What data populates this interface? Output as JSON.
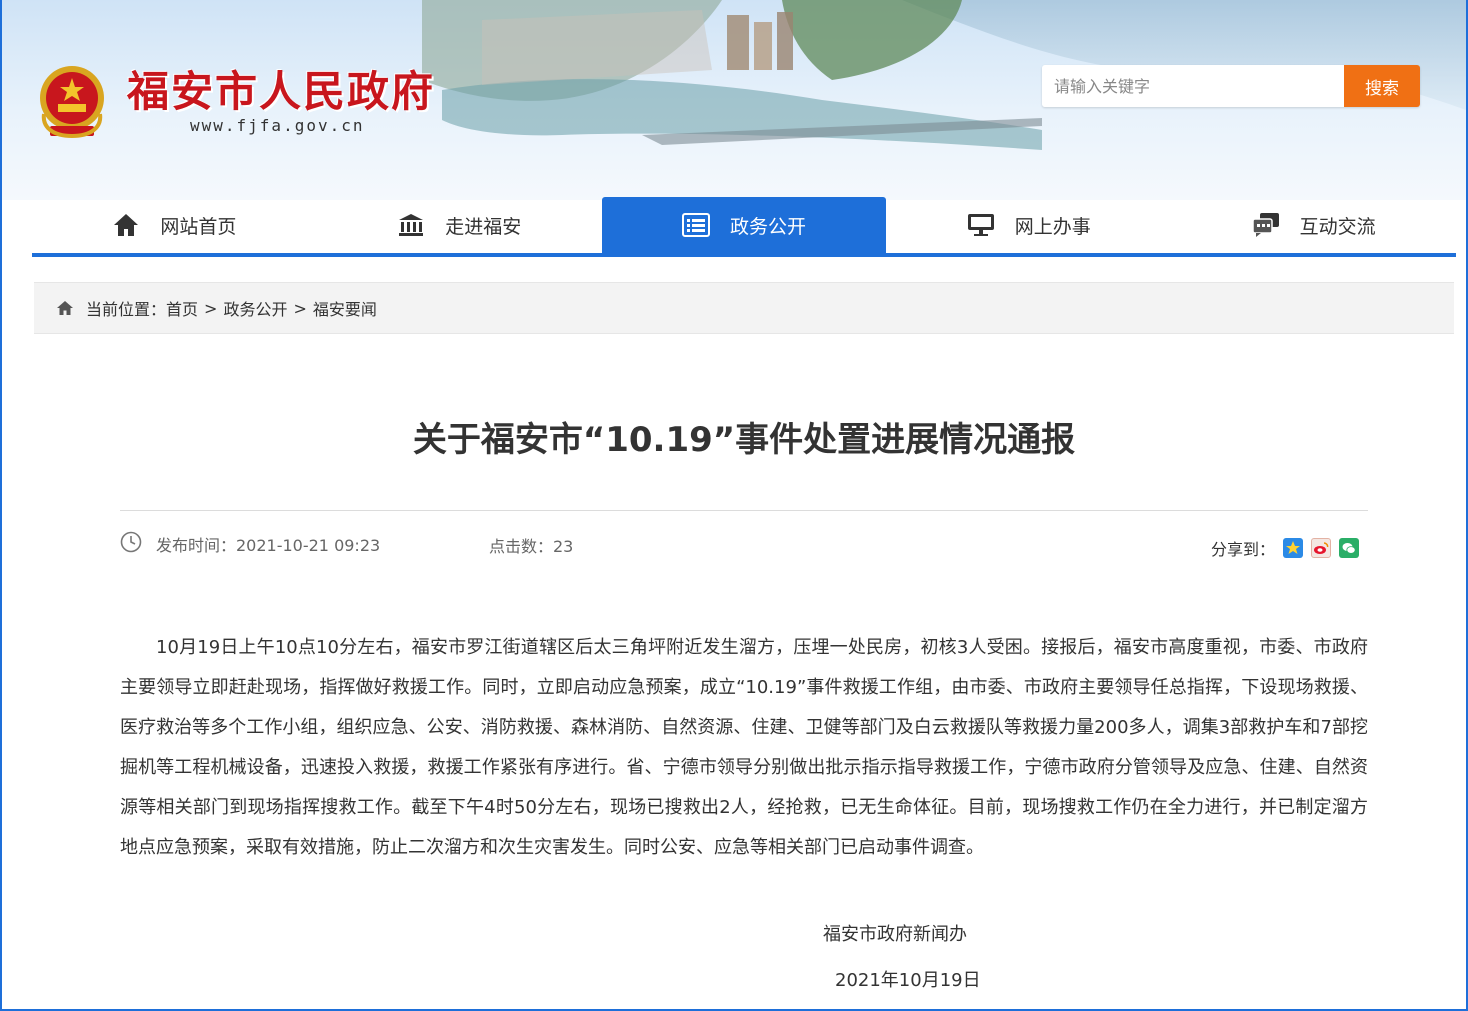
{
  "header": {
    "site_title": "福安市人民政府",
    "site_url": "www.fjfa.gov.cn",
    "search_placeholder": "请输入关键字",
    "search_button": "搜索"
  },
  "nav": {
    "items": [
      {
        "label": "网站首页",
        "icon": "home-icon"
      },
      {
        "label": "走进福安",
        "icon": "building-icon"
      },
      {
        "label": "政务公开",
        "icon": "list-icon",
        "active": true
      },
      {
        "label": "网上办事",
        "icon": "monitor-icon"
      },
      {
        "label": "互动交流",
        "icon": "chat-icon"
      }
    ]
  },
  "breadcrumb": {
    "prefix": "当前位置：",
    "items": [
      "首页",
      "政务公开",
      "福安要闻"
    ],
    "separator": ">"
  },
  "article": {
    "title": "关于福安市“10.19”事件处置进展情况通报",
    "publish_label": "发布时间：2021-10-21 09:23",
    "clicks_label": "点击数：23",
    "share_label": "分享到：",
    "share_targets": [
      "qzone-icon",
      "weibo-icon",
      "wechat-icon"
    ],
    "body": "10月19日上午10点10分左右，福安市罗江街道辖区后太三角坪附近发生溜方，压埋一处民房，初核3人受困。接报后，福安市高度重视，市委、市政府主要领导立即赶赴现场，指挥做好救援工作。同时，立即启动应急预案，成立“10.19”事件救援工作组，由市委、市政府主要领导任总指挥，下设现场救援、医疗救治等多个工作小组，组织应急、公安、消防救援、森林消防、自然资源、住建、卫健等部门及白云救援队等救援力量200多人，调集3部救护车和7部挖掘机等工程机械设备，迅速投入救援，救援工作紧张有序进行。省、宁德市领导分别做出批示指示指导救援工作，宁德市政府分管领导及应急、住建、自然资源等相关部门到现场指挥搜救工作。截至下午4时50分左右，现场已搜救出2人，经抢救，已无生命体征。目前，现场搜救工作仍在全力进行，并已制定溜方地点应急预案，采取有效措施，防止二次溜方和次生灾害发生。同时公安、应急等相关部门已启动事件调查。",
    "signature": "福安市政府新闻办",
    "sign_date": "2021年10月19日"
  },
  "colors": {
    "accent_blue": "#1e6fd9",
    "title_red": "#c8161d",
    "search_orange": "#f07014"
  }
}
